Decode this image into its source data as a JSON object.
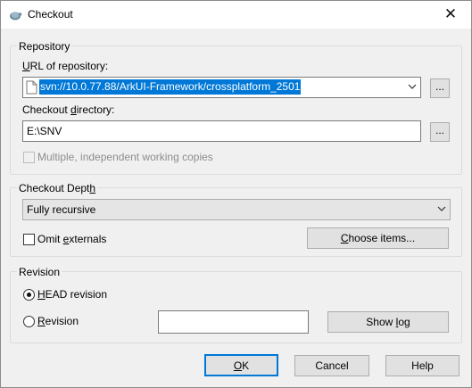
{
  "window": {
    "title": "Checkout",
    "close_glyph": "✕"
  },
  "repository": {
    "legend": "Repository",
    "url_label_prefix": "",
    "url_label_hotkey": "U",
    "url_label_rest": "RL of repository:",
    "url_value": "svn://10.0.77.88/ArkUI-Framework/crossplatform_2501",
    "browse_label": "...",
    "dir_label_a": "Checkout ",
    "dir_label_hotkey": "d",
    "dir_label_b": "irectory:",
    "dir_value": "E:\\SNV",
    "browse2_label": "...",
    "multiple_label_a": "Multiple",
    "multiple_label_b": ", independent working copies",
    "multiple_checked": false
  },
  "depth": {
    "legend_a": "Checkout Dept",
    "legend_hotkey": "h",
    "selected": "Fully recursive",
    "omit_a": "Omit ",
    "omit_hotkey": "e",
    "omit_b": "xternals",
    "omit_checked": false,
    "choose_a": "",
    "choose_hotkey": "C",
    "choose_b": "hoose items..."
  },
  "revision": {
    "legend": "Revision",
    "head_hotkey": "H",
    "head_rest": "EAD revision",
    "head_selected": true,
    "rev_hotkey": "R",
    "rev_rest": "evision",
    "rev_value": "",
    "showlog_a": "Show ",
    "showlog_hotkey": "l",
    "showlog_b": "og"
  },
  "buttons": {
    "ok_hotkey": "O",
    "ok_rest": "K",
    "cancel": "Cancel",
    "help": "Help"
  }
}
